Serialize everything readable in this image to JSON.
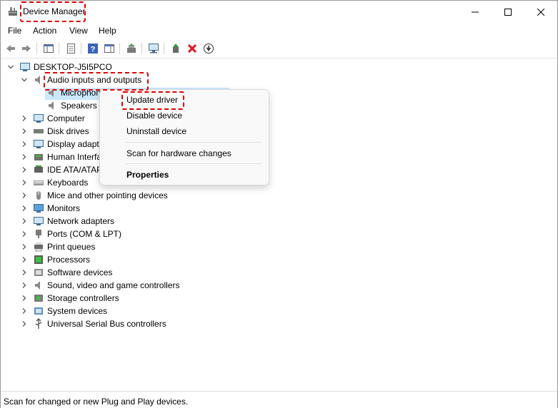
{
  "window": {
    "title": "Device Manager"
  },
  "menu": [
    "File",
    "Action",
    "View",
    "Help"
  ],
  "tree": {
    "root": "DESKTOP-J5I5PCO",
    "audio": {
      "label": "Audio inputs and outputs",
      "children": [
        "Microphone",
        "Speakers ("
      ]
    },
    "categories": [
      "Computer",
      "Disk drives",
      "Display adapte",
      "Human Interfa",
      "IDE ATA/ATAP",
      "Keyboards",
      "Mice and other pointing devices",
      "Monitors",
      "Network adapters",
      "Ports (COM & LPT)",
      "Print queues",
      "Processors",
      "Software devices",
      "Sound, video and game controllers",
      "Storage controllers",
      "System devices",
      "Universal Serial Bus controllers"
    ]
  },
  "context_menu": {
    "update_driver": "Update driver",
    "disable_device": "Disable device",
    "uninstall_device": "Uninstall device",
    "scan": "Scan for hardware changes",
    "properties": "Properties"
  },
  "status": "Scan for changed or new Plug and Play devices.",
  "colors": {
    "highlight": "#e00000",
    "selection": "#cce8ff",
    "uninstall_x": "#e0151c"
  }
}
